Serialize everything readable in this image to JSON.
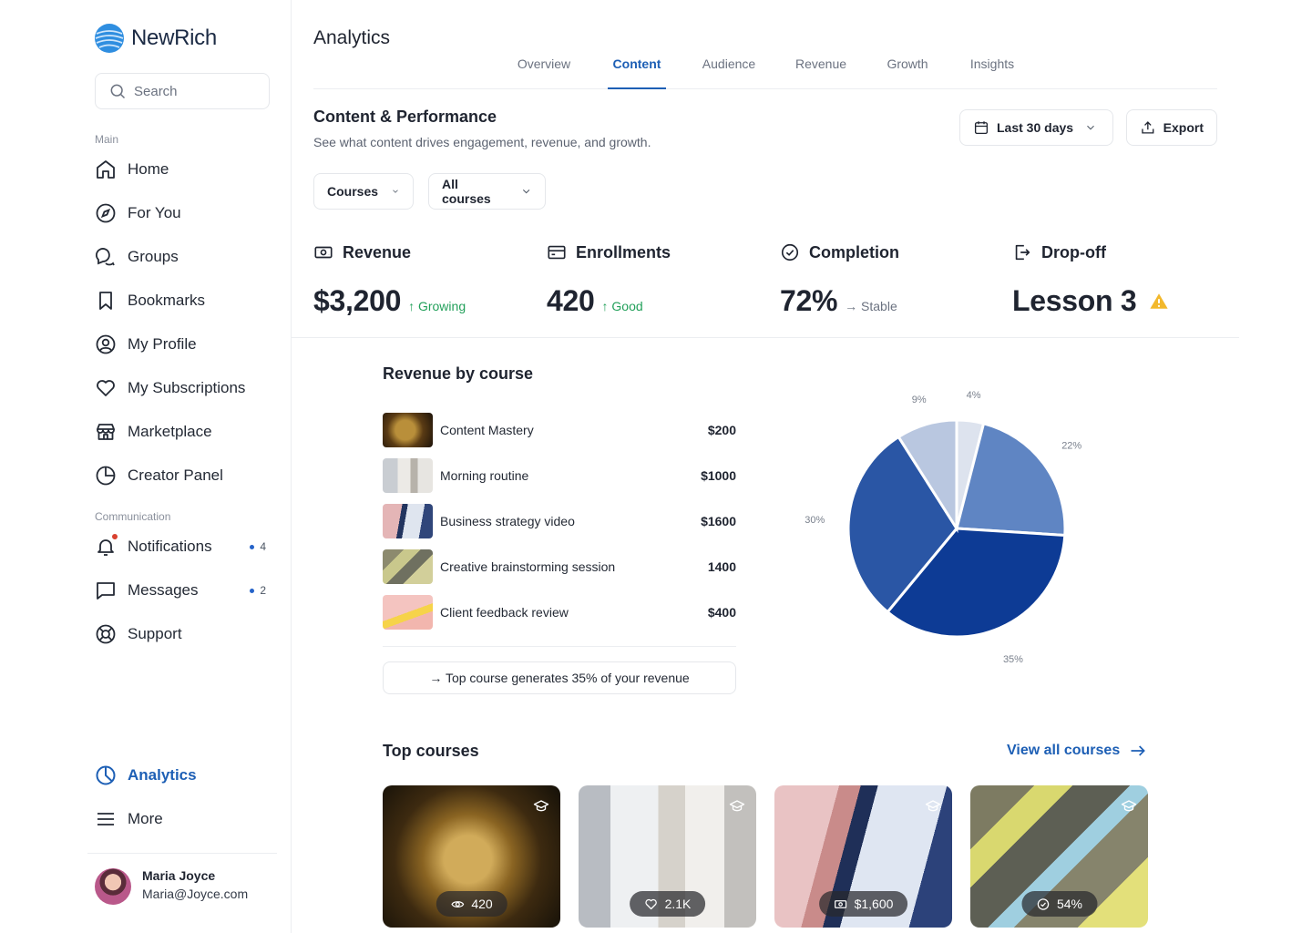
{
  "brand": {
    "name": "NewRich"
  },
  "search": {
    "placeholder": "Search"
  },
  "sidebar": {
    "main_label": "Main",
    "main_items": [
      {
        "label": "Home",
        "icon": "home-icon"
      },
      {
        "label": "For You",
        "icon": "compass-icon"
      },
      {
        "label": "Groups",
        "icon": "groups-icon"
      },
      {
        "label": "Bookmarks",
        "icon": "bookmark-icon"
      },
      {
        "label": "My Profile",
        "icon": "profile-icon"
      },
      {
        "label": "My Subscriptions",
        "icon": "heart-icon"
      },
      {
        "label": "Marketplace",
        "icon": "store-icon"
      },
      {
        "label": "Creator Panel",
        "icon": "pie-chart-icon"
      }
    ],
    "communication_label": "Communication",
    "communication_items": [
      {
        "label": "Notifications",
        "icon": "bell-icon",
        "count": "4"
      },
      {
        "label": "Messages",
        "icon": "message-icon",
        "count": "2"
      },
      {
        "label": "Support",
        "icon": "lifebuoy-icon"
      }
    ],
    "bottom_items": [
      {
        "label": "Analytics",
        "icon": "analytics-icon",
        "active": true
      },
      {
        "label": "More",
        "icon": "menu-icon"
      }
    ]
  },
  "user": {
    "name": "Maria Joyce",
    "email": "Maria@Joyce.com"
  },
  "header": {
    "title": "Analytics",
    "tabs": [
      "Overview",
      "Content",
      "Audience",
      "Revenue",
      "Growth",
      "Insights"
    ],
    "active_tab": "Content"
  },
  "section": {
    "title": "Content & Performance",
    "subtitle": "See what content drives engagement, revenue, and growth.",
    "date_range": "Last 30 days",
    "export_label": "Export",
    "filter_type": "Courses",
    "filter_scope": "All courses"
  },
  "metrics": {
    "revenue": {
      "label": "Revenue",
      "value": "$3,200",
      "trend": "↑ Growing"
    },
    "enrollments": {
      "label": "Enrollments",
      "value": "420",
      "trend": "↑ Good"
    },
    "completion": {
      "label": "Completion",
      "value": "72%",
      "trend": "→ Stable"
    },
    "dropoff": {
      "label": "Drop-off",
      "value": "Lesson 3"
    }
  },
  "revenue_by_course": {
    "title": "Revenue by course",
    "courses": [
      {
        "name": "Content Mastery",
        "amount": "$200"
      },
      {
        "name": "Morning routine",
        "amount": "$1000"
      },
      {
        "name": "Business strategy video",
        "amount": "$1600"
      },
      {
        "name": "Creative brainstorming session",
        "amount": "1400"
      },
      {
        "name": "Client feedback review",
        "amount": "$400"
      }
    ],
    "insight": "→ Top course generates 35% of your revenue"
  },
  "chart_data": {
    "type": "pie",
    "values": [
      4,
      22,
      35,
      30,
      9
    ],
    "labels": [
      "4%",
      "22%",
      "35%",
      "30%",
      "9%"
    ],
    "colors": [
      "#dde3ee",
      "#5f85c3",
      "#0d3b95",
      "#2a56a5",
      "#b9c7e0"
    ],
    "title": ""
  },
  "top_courses": {
    "title": "Top courses",
    "view_all": "View all courses",
    "cards": [
      {
        "stat": "420",
        "icon": "eye-icon"
      },
      {
        "stat": "2.1K",
        "icon": "heart-icon"
      },
      {
        "stat": "$1,600",
        "icon": "cash-icon"
      },
      {
        "stat": "54%",
        "icon": "check-circle-icon"
      }
    ]
  }
}
